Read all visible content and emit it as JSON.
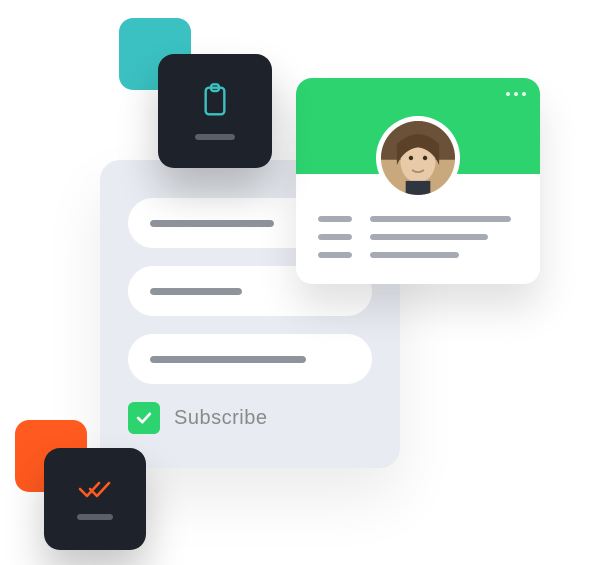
{
  "colors": {
    "teal": "#3bc1c1",
    "orange": "#ff5a1f",
    "green": "#2dd36f",
    "dark": "#1e222a",
    "formBg": "#e8ebf1"
  },
  "form": {
    "subscribe_label": "Subscribe",
    "subscribe_checked": true
  },
  "profile": {
    "more_icon": "more-horizontal-icon",
    "avatar": "user-avatar"
  },
  "cards": {
    "clipboard_icon": "clipboard-icon",
    "checkmarks_icon": "double-check-icon"
  }
}
